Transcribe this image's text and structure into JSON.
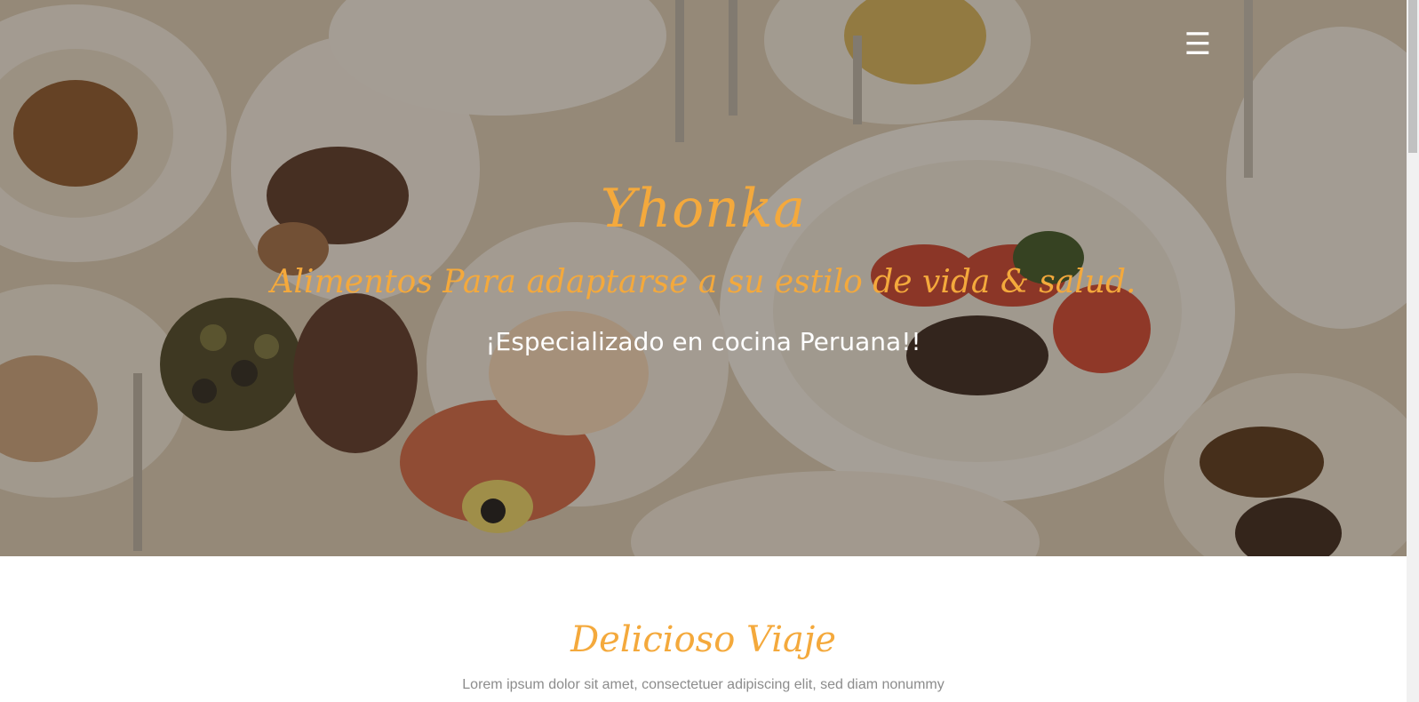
{
  "hero": {
    "brand": "Yhonka",
    "tagline": "Alimentos Para adaptarse a su estilo de vida & salud.",
    "specialty": "¡Especializado en cocina Peruana!!",
    "menu_icon": "☰",
    "menu_icon_name": "hamburger-menu-icon",
    "accent_color": "#f4a93c"
  },
  "section": {
    "title": "Delicioso Viaje",
    "text": "Lorem ipsum dolor sit amet, consectetuer adipiscing elit, sed diam nonummy"
  }
}
